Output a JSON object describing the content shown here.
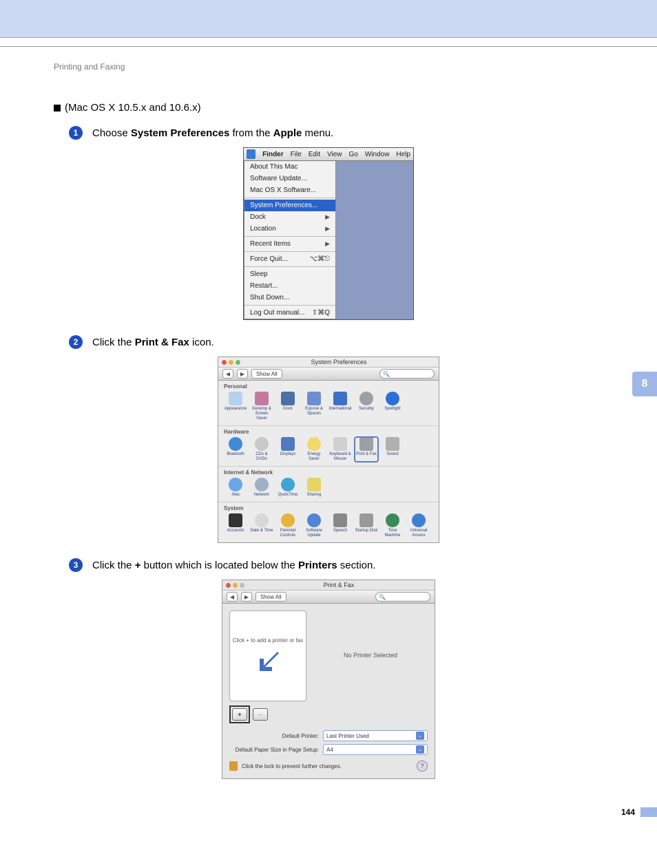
{
  "header_title": "Printing and Faxing",
  "section_title": "(Mac OS X 10.5.x and 10.6.x)",
  "side_tab": "8",
  "page_number": "144",
  "steps": {
    "s1": {
      "pre": "Choose ",
      "b1": "System Preferences",
      "mid": " from the ",
      "b2": "Apple",
      "post": " menu."
    },
    "s2": {
      "pre": "Click the ",
      "b1": "Print & Fax",
      "post": " icon."
    },
    "s3": {
      "pre": "Click the ",
      "b1": "+",
      "mid": " button which is located below the ",
      "b2": "Printers",
      "post": " section."
    }
  },
  "shot1": {
    "menubar": {
      "finder": "Finder",
      "file": "File",
      "edit": "Edit",
      "view": "View",
      "go": "Go",
      "window": "Window",
      "help": "Help"
    },
    "menu": {
      "about": "About This Mac",
      "swupdate": "Software Update...",
      "macsw": "Mac OS X Software...",
      "sysprefs": "System Preferences...",
      "dock": "Dock",
      "location": "Location",
      "recent": "Recent Items",
      "forcequit": "Force Quit...",
      "forcequit_key": "⌥⌘⎋",
      "sleep": "Sleep",
      "restart": "Restart...",
      "shutdown": "Shut Down...",
      "logout": "Log Out manual...",
      "logout_key": "⇧⌘Q"
    }
  },
  "shot2": {
    "title": "System Preferences",
    "showall": "Show All",
    "search_icon": "🔍",
    "cats": {
      "personal": {
        "h": "Personal",
        "items": [
          "Appearance",
          "Desktop & Screen Saver",
          "Dock",
          "Exposé & Spaces",
          "International",
          "Security",
          "Spotlight"
        ]
      },
      "hardware": {
        "h": "Hardware",
        "items": [
          "Bluetooth",
          "CDs & DVDs",
          "Displays",
          "Energy Saver",
          "Keyboard & Mouse",
          "Print & Fax",
          "Sound"
        ]
      },
      "internet": {
        "h": "Internet & Network",
        "items": [
          ".Mac",
          "Network",
          "QuickTime",
          "Sharing"
        ]
      },
      "system": {
        "h": "System",
        "items": [
          "Accounts",
          "Date & Time",
          "Parental Controls",
          "Software Update",
          "Speech",
          "Startup Disk",
          "Time Machine",
          "Universal Access"
        ]
      }
    },
    "selected": "Print & Fax"
  },
  "shot3": {
    "title": "Print & Fax",
    "showall": "Show All",
    "left_hint": "Click + to add a printer or fax",
    "right_hint": "No Printer Selected",
    "plus": "+",
    "minus": "–",
    "default_printer_label": "Default Printer:",
    "default_printer_value": "Last Printer Used",
    "paper_label": "Default Paper Size in Page Setup:",
    "paper_value": "A4",
    "lock_text": "Click the lock to prevent further changes.",
    "help": "?"
  }
}
